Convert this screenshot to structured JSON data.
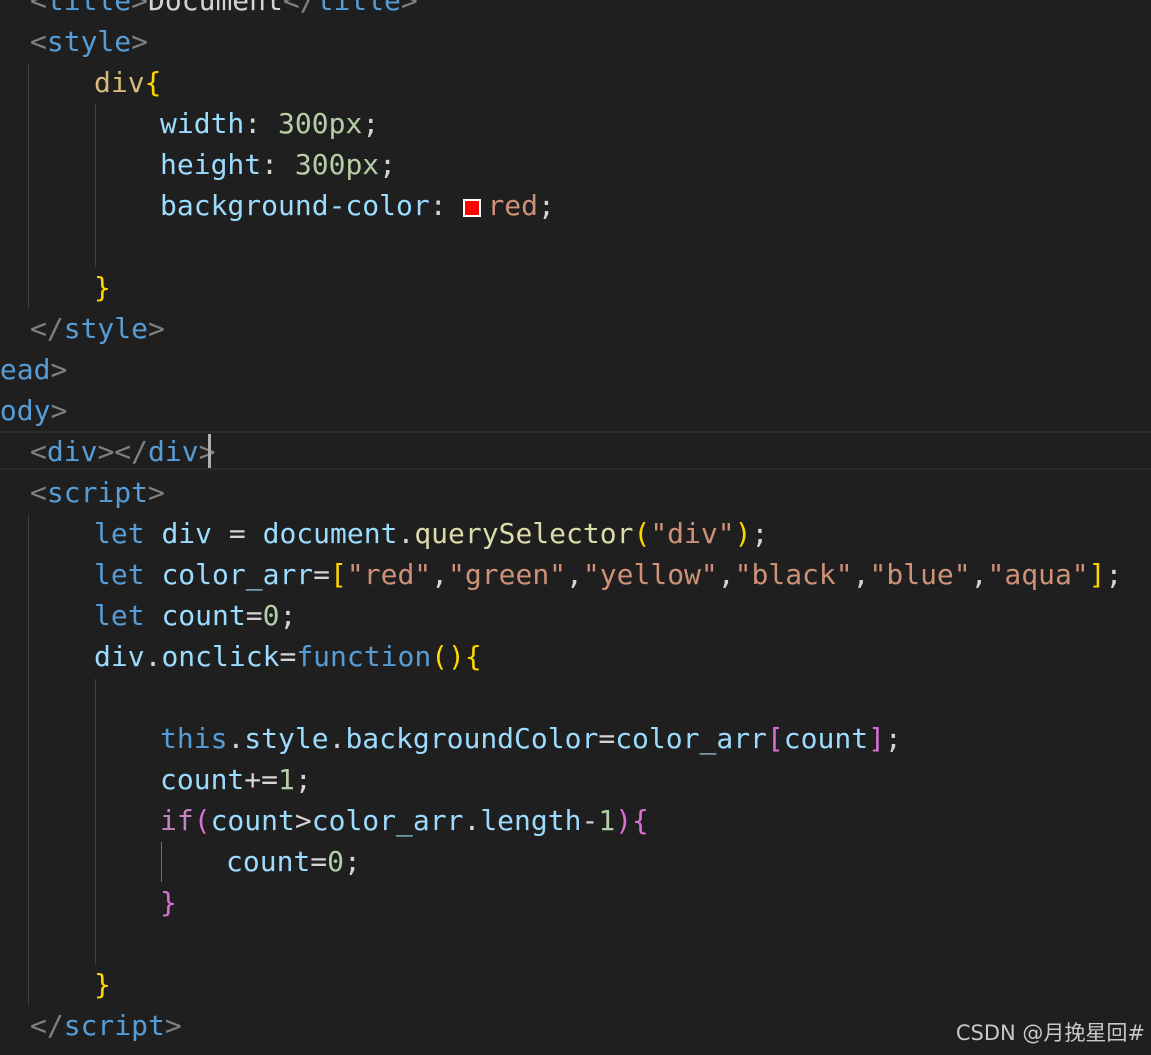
{
  "editor": {
    "theme": {
      "background": "#1f1f1f"
    },
    "colors": {
      "tag": "#569cd6",
      "punct": "#808080",
      "selector": "#d7ba7d",
      "brace": "#ffd700",
      "brace2": "#da70d6",
      "brace3": "#179fff",
      "prop": "#9cdcfe",
      "num": "#b5cea8",
      "value": "#ce9178",
      "keyword": "#569cd6",
      "control": "#c586c0",
      "variable": "#9cdcfe",
      "func": "#dcdcaa",
      "text": "#d4d4d4",
      "swatch": "#ff0000"
    },
    "lines": [
      {
        "indent": 30,
        "tokens": [
          {
            "t": "<",
            "c": "punct"
          },
          {
            "t": "title",
            "c": "tag"
          },
          {
            "t": ">",
            "c": "punct"
          },
          {
            "t": "Document",
            "c": "text"
          },
          {
            "t": "</",
            "c": "punct"
          },
          {
            "t": "title",
            "c": "tag"
          },
          {
            "t": ">",
            "c": "punct"
          }
        ]
      },
      {
        "indent": 30,
        "tokens": [
          {
            "t": "<",
            "c": "punct"
          },
          {
            "t": "style",
            "c": "tag"
          },
          {
            "t": ">",
            "c": "punct"
          }
        ]
      },
      {
        "indent": 94,
        "tokens": [
          {
            "t": "div",
            "c": "selector"
          },
          {
            "t": "{",
            "c": "brace"
          }
        ]
      },
      {
        "indent": 160,
        "tokens": [
          {
            "t": "width",
            "c": "prop"
          },
          {
            "t": ": ",
            "c": "text"
          },
          {
            "t": "300px",
            "c": "num"
          },
          {
            "t": ";",
            "c": "text"
          }
        ]
      },
      {
        "indent": 160,
        "tokens": [
          {
            "t": "height",
            "c": "prop"
          },
          {
            "t": ": ",
            "c": "text"
          },
          {
            "t": "300px",
            "c": "num"
          },
          {
            "t": ";",
            "c": "text"
          }
        ]
      },
      {
        "indent": 160,
        "tokens": [
          {
            "t": "background-color",
            "c": "prop"
          },
          {
            "t": ": ",
            "c": "text"
          },
          {
            "swatch": true
          },
          {
            "t": "red",
            "c": "value"
          },
          {
            "t": ";",
            "c": "text"
          }
        ]
      },
      {
        "indent": 160,
        "tokens": []
      },
      {
        "indent": 94,
        "tokens": [
          {
            "t": "}",
            "c": "brace"
          }
        ]
      },
      {
        "indent": 30,
        "tokens": [
          {
            "t": "</",
            "c": "punct"
          },
          {
            "t": "style",
            "c": "tag"
          },
          {
            "t": ">",
            "c": "punct"
          }
        ]
      },
      {
        "indent": -17,
        "tokens": [
          {
            "t": "head",
            "c": "tag"
          },
          {
            "t": ">",
            "c": "punct"
          }
        ]
      },
      {
        "indent": -17,
        "tokens": [
          {
            "t": "body",
            "c": "tag"
          },
          {
            "t": ">",
            "c": "punct"
          }
        ]
      },
      {
        "indent": 30,
        "tokens": [
          {
            "t": "<",
            "c": "punct"
          },
          {
            "t": "div",
            "c": "tag"
          },
          {
            "t": "></",
            "c": "punct"
          },
          {
            "t": "div",
            "c": "tag"
          },
          {
            "t": ">",
            "c": "punct"
          }
        ]
      },
      {
        "indent": 30,
        "tokens": [
          {
            "t": "<",
            "c": "punct"
          },
          {
            "t": "script",
            "c": "tag"
          },
          {
            "t": ">",
            "c": "punct"
          }
        ]
      },
      {
        "indent": 94,
        "tokens": [
          {
            "t": "let",
            "c": "keyword"
          },
          {
            "t": " ",
            "c": "text"
          },
          {
            "t": "div",
            "c": "variable"
          },
          {
            "t": " = ",
            "c": "text"
          },
          {
            "t": "document",
            "c": "variable"
          },
          {
            "t": ".",
            "c": "text"
          },
          {
            "t": "querySelector",
            "c": "func"
          },
          {
            "t": "(",
            "c": "brace"
          },
          {
            "t": "\"div\"",
            "c": "value"
          },
          {
            "t": ")",
            "c": "brace"
          },
          {
            "t": ";",
            "c": "text"
          }
        ]
      },
      {
        "indent": 94,
        "tokens": [
          {
            "t": "let",
            "c": "keyword"
          },
          {
            "t": " ",
            "c": "text"
          },
          {
            "t": "color_arr",
            "c": "variable"
          },
          {
            "t": "=",
            "c": "text"
          },
          {
            "t": "[",
            "c": "brace"
          },
          {
            "t": "\"red\"",
            "c": "value"
          },
          {
            "t": ",",
            "c": "text"
          },
          {
            "t": "\"green\"",
            "c": "value"
          },
          {
            "t": ",",
            "c": "text"
          },
          {
            "t": "\"yellow\"",
            "c": "value"
          },
          {
            "t": ",",
            "c": "text"
          },
          {
            "t": "\"black\"",
            "c": "value"
          },
          {
            "t": ",",
            "c": "text"
          },
          {
            "t": "\"blue\"",
            "c": "value"
          },
          {
            "t": ",",
            "c": "text"
          },
          {
            "t": "\"aqua\"",
            "c": "value"
          },
          {
            "t": "]",
            "c": "brace"
          },
          {
            "t": ";",
            "c": "text"
          }
        ]
      },
      {
        "indent": 94,
        "tokens": [
          {
            "t": "let",
            "c": "keyword"
          },
          {
            "t": " ",
            "c": "text"
          },
          {
            "t": "count",
            "c": "variable"
          },
          {
            "t": "=",
            "c": "text"
          },
          {
            "t": "0",
            "c": "num"
          },
          {
            "t": ";",
            "c": "text"
          }
        ]
      },
      {
        "indent": 94,
        "tokens": [
          {
            "t": "div",
            "c": "variable"
          },
          {
            "t": ".",
            "c": "text"
          },
          {
            "t": "onclick",
            "c": "variable"
          },
          {
            "t": "=",
            "c": "text"
          },
          {
            "t": "function",
            "c": "keyword"
          },
          {
            "t": "()",
            "c": "brace"
          },
          {
            "t": "{",
            "c": "brace"
          }
        ]
      },
      {
        "indent": 160,
        "tokens": []
      },
      {
        "indent": 160,
        "tokens": [
          {
            "t": "this",
            "c": "keyword"
          },
          {
            "t": ".",
            "c": "text"
          },
          {
            "t": "style",
            "c": "variable"
          },
          {
            "t": ".",
            "c": "text"
          },
          {
            "t": "backgroundColor",
            "c": "variable"
          },
          {
            "t": "=",
            "c": "text"
          },
          {
            "t": "color_arr",
            "c": "variable"
          },
          {
            "t": "[",
            "c": "brace2"
          },
          {
            "t": "count",
            "c": "variable"
          },
          {
            "t": "]",
            "c": "brace2"
          },
          {
            "t": ";",
            "c": "text"
          }
        ]
      },
      {
        "indent": 160,
        "tokens": [
          {
            "t": "count",
            "c": "variable"
          },
          {
            "t": "+=",
            "c": "text"
          },
          {
            "t": "1",
            "c": "num"
          },
          {
            "t": ";",
            "c": "text"
          }
        ]
      },
      {
        "indent": 160,
        "tokens": [
          {
            "t": "if",
            "c": "control"
          },
          {
            "t": "(",
            "c": "brace2"
          },
          {
            "t": "count",
            "c": "variable"
          },
          {
            "t": ">",
            "c": "text"
          },
          {
            "t": "color_arr",
            "c": "variable"
          },
          {
            "t": ".",
            "c": "text"
          },
          {
            "t": "length",
            "c": "variable"
          },
          {
            "t": "-",
            "c": "text"
          },
          {
            "t": "1",
            "c": "num"
          },
          {
            "t": ")",
            "c": "brace2"
          },
          {
            "t": "{",
            "c": "brace2"
          }
        ]
      },
      {
        "indent": 226,
        "tokens": [
          {
            "t": "count",
            "c": "variable"
          },
          {
            "t": "=",
            "c": "text"
          },
          {
            "t": "0",
            "c": "num"
          },
          {
            "t": ";",
            "c": "text"
          }
        ]
      },
      {
        "indent": 160,
        "tokens": [
          {
            "t": "}",
            "c": "brace2"
          }
        ]
      },
      {
        "indent": 160,
        "tokens": []
      },
      {
        "indent": 94,
        "tokens": [
          {
            "t": "}",
            "c": "brace"
          }
        ]
      },
      {
        "indent": 30,
        "tokens": [
          {
            "t": "</",
            "c": "punct"
          },
          {
            "t": "script",
            "c": "tag"
          },
          {
            "t": ">",
            "c": "punct"
          }
        ]
      }
    ]
  },
  "watermark": {
    "text": "CSDN @月挽星回#"
  }
}
